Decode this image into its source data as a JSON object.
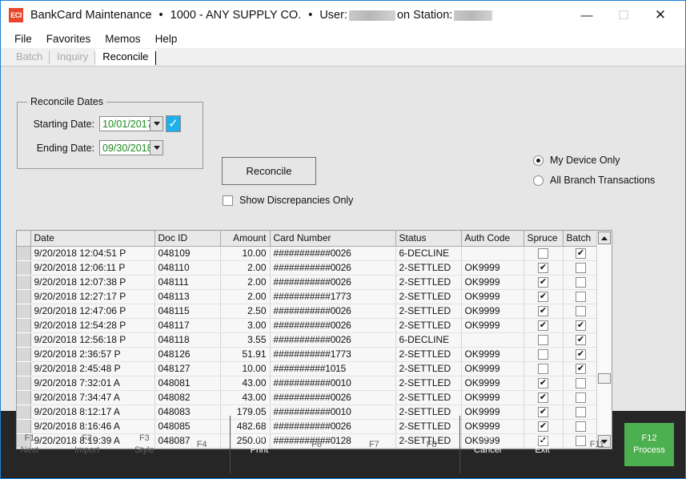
{
  "window": {
    "app_icon_text": "ECI",
    "title": "BankCard Maintenance",
    "separator": "•",
    "company": "1000 - ANY SUPPLY CO.",
    "user_label": "User:",
    "station_label": "on Station:",
    "minimize_glyph": "—",
    "maximize_glyph": "☐",
    "close_glyph": "✕"
  },
  "menubar": {
    "items": [
      {
        "label": "File"
      },
      {
        "label": "Favorites"
      },
      {
        "label": "Memos"
      },
      {
        "label": "Help"
      }
    ]
  },
  "tabs": [
    {
      "label": "Batch",
      "active": false
    },
    {
      "label": "Inquiry",
      "active": false
    },
    {
      "label": "Reconcile",
      "active": true
    }
  ],
  "reconcile_dates": {
    "group_title": "Reconcile Dates",
    "starting_label": "Starting Date:",
    "starting_value": "10/01/2017",
    "starting_confirm_glyph": "✓",
    "ending_label": "Ending Date:",
    "ending_value": "09/30/2018"
  },
  "actions": {
    "reconcile_button": "Reconcile",
    "show_discrepancies_label": "Show Discrepancies Only",
    "show_discrepancies_checked": false
  },
  "scope": {
    "options": [
      {
        "label": "My Device Only",
        "selected": true
      },
      {
        "label": "All Branch Transactions",
        "selected": false
      }
    ]
  },
  "grid": {
    "columns": [
      {
        "key": "date",
        "label": "Date",
        "align": "left"
      },
      {
        "key": "doc_id",
        "label": "Doc ID",
        "align": "left"
      },
      {
        "key": "amount",
        "label": "Amount",
        "align": "right"
      },
      {
        "key": "card_number",
        "label": "Card Number",
        "align": "left"
      },
      {
        "key": "status",
        "label": "Status",
        "align": "left"
      },
      {
        "key": "auth_code",
        "label": "Auth Code",
        "align": "left"
      },
      {
        "key": "spruce",
        "label": "Spruce",
        "align": "center"
      },
      {
        "key": "batch",
        "label": "Batch",
        "align": "center"
      }
    ],
    "checked_glyph": "✔",
    "rows": [
      {
        "date": "9/20/2018 12:04:51 P",
        "doc_id": "048109",
        "amount": "10.00",
        "card_number": "###########0026",
        "status": "6-DECLINE",
        "auth_code": "",
        "spruce": false,
        "batch": true
      },
      {
        "date": "9/20/2018 12:06:11 P",
        "doc_id": "048110",
        "amount": "2.00",
        "card_number": "###########0026",
        "status": "2-SETTLED",
        "auth_code": "OK9999",
        "spruce": true,
        "batch": false
      },
      {
        "date": "9/20/2018 12:07:38 P",
        "doc_id": "048111",
        "amount": "2.00",
        "card_number": "###########0026",
        "status": "2-SETTLED",
        "auth_code": "OK9999",
        "spruce": true,
        "batch": false
      },
      {
        "date": "9/20/2018 12:27:17 P",
        "doc_id": "048113",
        "amount": "2.00",
        "card_number": "###########1773",
        "status": "2-SETTLED",
        "auth_code": "OK9999",
        "spruce": true,
        "batch": false
      },
      {
        "date": "9/20/2018 12:47:06 P",
        "doc_id": "048115",
        "amount": "2.50",
        "card_number": "###########0026",
        "status": "2-SETTLED",
        "auth_code": "OK9999",
        "spruce": true,
        "batch": false
      },
      {
        "date": "9/20/2018 12:54:28 P",
        "doc_id": "048117",
        "amount": "3.00",
        "card_number": "###########0026",
        "status": "2-SETTLED",
        "auth_code": "OK9999",
        "spruce": true,
        "batch": true
      },
      {
        "date": "9/20/2018 12:56:18 P",
        "doc_id": "048118",
        "amount": "3.55",
        "card_number": "###########0026",
        "status": "6-DECLINE",
        "auth_code": "",
        "spruce": false,
        "batch": true
      },
      {
        "date": "9/20/2018 2:36:57 P",
        "doc_id": "048126",
        "amount": "51.91",
        "card_number": "###########1773",
        "status": "2-SETTLED",
        "auth_code": "OK9999",
        "spruce": false,
        "batch": true
      },
      {
        "date": "9/20/2018 2:45:48 P",
        "doc_id": "048127",
        "amount": "10.00",
        "card_number": "##########1015",
        "status": "2-SETTLED",
        "auth_code": "OK9999",
        "spruce": false,
        "batch": true
      },
      {
        "date": "9/20/2018 7:32:01 A",
        "doc_id": "048081",
        "amount": "43.00",
        "card_number": "###########0010",
        "status": "2-SETTLED",
        "auth_code": "OK9999",
        "spruce": true,
        "batch": false
      },
      {
        "date": "9/20/2018 7:34:47 A",
        "doc_id": "048082",
        "amount": "43.00",
        "card_number": "###########0026",
        "status": "2-SETTLED",
        "auth_code": "OK9999",
        "spruce": true,
        "batch": false
      },
      {
        "date": "9/20/2018 8:12:17 A",
        "doc_id": "048083",
        "amount": "179.05",
        "card_number": "###########0010",
        "status": "2-SETTLED",
        "auth_code": "OK9999",
        "spruce": true,
        "batch": false
      },
      {
        "date": "9/20/2018 8:16:46 A",
        "doc_id": "048085",
        "amount": "482.68",
        "card_number": "###########0026",
        "status": "2-SETTLED",
        "auth_code": "OK9999",
        "spruce": true,
        "batch": false
      },
      {
        "date": "9/20/2018 8:19:39 A",
        "doc_id": "048087",
        "amount": "250.00",
        "card_number": "###########0128",
        "status": "2-SETTLED",
        "auth_code": "OK9999",
        "spruce": true,
        "batch": false
      }
    ]
  },
  "function_keys": {
    "primary_color": "#4caf50",
    "groups": [
      {
        "keys": [
          {
            "key": "F1",
            "label": "Next",
            "enabled": false,
            "primary": false
          },
          {
            "key": "F2",
            "label": "Import",
            "enabled": false,
            "primary": false
          },
          {
            "key": "F3",
            "label": "Style",
            "enabled": false,
            "primary": false
          },
          {
            "key": "F4",
            "label": "",
            "enabled": false,
            "primary": false
          }
        ]
      },
      {
        "keys": [
          {
            "key": "F5",
            "label": "Print",
            "enabled": true,
            "primary": false
          },
          {
            "key": "F6",
            "label": "",
            "enabled": false,
            "primary": false
          },
          {
            "key": "F7",
            "label": "",
            "enabled": false,
            "primary": false
          },
          {
            "key": "F8",
            "label": "",
            "enabled": false,
            "primary": false
          }
        ]
      },
      {
        "keys": [
          {
            "key": "F9",
            "label": "Cancel",
            "enabled": true,
            "primary": false
          },
          {
            "key": "F10",
            "label": "Exit",
            "enabled": true,
            "primary": false
          },
          {
            "key": "F11",
            "label": "",
            "enabled": false,
            "primary": false
          },
          {
            "key": "F12",
            "label": "Process",
            "enabled": true,
            "primary": true
          }
        ]
      }
    ]
  }
}
